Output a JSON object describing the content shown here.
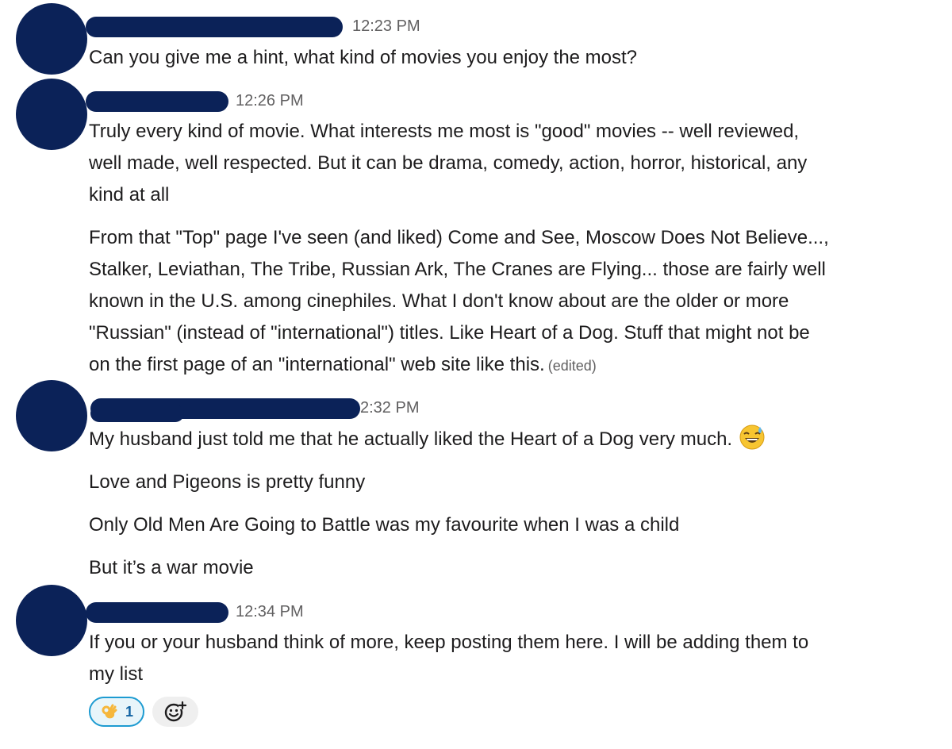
{
  "messages": [
    {
      "time": "12:23 PM",
      "lines": [
        "Can you give me a hint, what kind of movies you enjoy the most?"
      ]
    },
    {
      "time": "12:26 PM",
      "lines": [
        "Truly every kind of movie. What interests me most is \"good\" movies -- well reviewed,",
        "well made, well respected. But it can be drama, comedy, action, horror, historical, any",
        "kind at all",
        "From that \"Top\" page I've seen (and liked) Come and See, Moscow Does Not Believe...,",
        "Stalker, Leviathan, The Tribe, Russian Ark, The Cranes are Flying...  those are fairly well",
        "known in the U.S. among cinephiles. What I don't know about are the older or more",
        "\"Russian\" (instead of \"international\") titles. Like Heart of a Dog. Stuff that might not be",
        "on the first page of an \"international\" web site like this."
      ],
      "edited": "(edited)"
    },
    {
      "time": "2:32 PM",
      "lines": [
        "My husband just told me that he actually liked the Heart of a Dog very much.",
        "Love and Pigeons is pretty funny",
        "Only Old Men Are Going to Battle was my favourite when I was a child",
        "But it’s a war movie"
      ],
      "emoji": "grinning-sweat-emoji"
    },
    {
      "time": "12:34 PM",
      "lines": [
        "If you or your husband think of more, keep posting them here. I will be adding them to",
        "my list"
      ]
    }
  ],
  "reactions": [
    {
      "emoji": "ok-hand-emoji",
      "count": "1"
    }
  ],
  "add_reaction_icon": "add-reaction-icon",
  "colors": {
    "avatar": "#0b2258",
    "redaction": "#0b2258",
    "reaction_border": "#1d9bd1",
    "reaction_bg": "#e8f5fa"
  }
}
